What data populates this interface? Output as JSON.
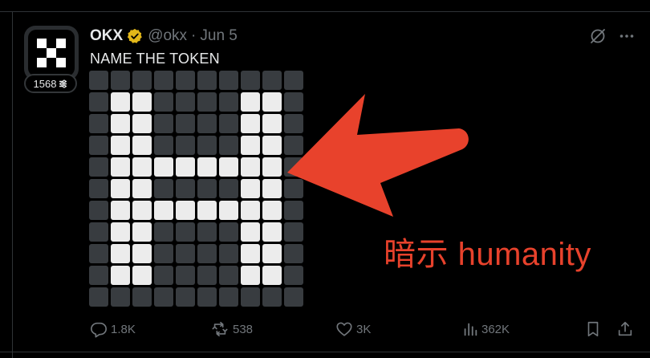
{
  "post": {
    "display_name": "OKX",
    "handle": "@okx",
    "separator": "·",
    "date": "Jun 5",
    "text": "NAME THE TOKEN",
    "avatar_badge_count": "1568"
  },
  "pixel_grid": {
    "columns": 10,
    "rows": 11,
    "lit_cells": [
      [
        1,
        1
      ],
      [
        1,
        2
      ],
      [
        1,
        7
      ],
      [
        1,
        8
      ],
      [
        2,
        1
      ],
      [
        2,
        2
      ],
      [
        2,
        7
      ],
      [
        2,
        8
      ],
      [
        3,
        1
      ],
      [
        3,
        2
      ],
      [
        3,
        7
      ],
      [
        3,
        8
      ],
      [
        4,
        1
      ],
      [
        4,
        2
      ],
      [
        4,
        3
      ],
      [
        4,
        4
      ],
      [
        4,
        5
      ],
      [
        4,
        6
      ],
      [
        4,
        7
      ],
      [
        4,
        8
      ],
      [
        5,
        1
      ],
      [
        5,
        2
      ],
      [
        5,
        7
      ],
      [
        5,
        8
      ],
      [
        6,
        1
      ],
      [
        6,
        2
      ],
      [
        6,
        3
      ],
      [
        6,
        4
      ],
      [
        6,
        5
      ],
      [
        6,
        6
      ],
      [
        6,
        7
      ],
      [
        6,
        8
      ],
      [
        7,
        1
      ],
      [
        7,
        2
      ],
      [
        7,
        7
      ],
      [
        7,
        8
      ],
      [
        8,
        1
      ],
      [
        8,
        2
      ],
      [
        8,
        7
      ],
      [
        8,
        8
      ],
      [
        9,
        1
      ],
      [
        9,
        2
      ],
      [
        9,
        7
      ],
      [
        9,
        8
      ]
    ],
    "colors": {
      "on": "#ececec",
      "off": "#383c40"
    }
  },
  "annotation": {
    "text": "暗示 humanity",
    "color": "#e8422c"
  },
  "actions": {
    "replies": "1.8K",
    "reposts": "538",
    "likes": "3K",
    "views": "362K"
  },
  "icons": {
    "verified": "verified-badge-icon",
    "grok": "grok-icon",
    "more": "more-icon",
    "reply": "reply-icon",
    "repost": "repost-icon",
    "like": "like-icon",
    "views": "views-icon",
    "bookmark": "bookmark-icon",
    "share": "share-icon"
  },
  "colors": {
    "background": "#000000",
    "text_primary": "#e7e9ea",
    "text_secondary": "#71767b",
    "verified_gold": "#e2b719",
    "arrow_red": "#e8422c"
  }
}
